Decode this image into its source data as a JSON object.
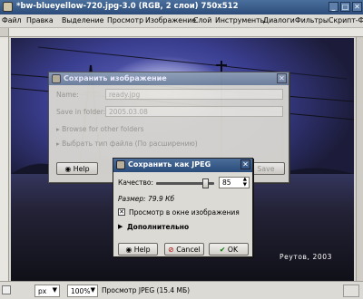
{
  "window": {
    "title": "*bw-blueyellow-720.jpg-3.0 (RGB, 2 слои) 750x512",
    "menu": [
      "Файл",
      "Правка",
      "Выделение",
      "Просмотр",
      "Изображение",
      "Слой",
      "Инструменты",
      "Диалоги",
      "Фильтры",
      "Скрипт-Ф"
    ]
  },
  "image": {
    "watermark": "Реутов, 2003"
  },
  "status": {
    "unit": "px",
    "zoom": "100%",
    "text": "Просмотр JPEG (15.4 МБ)"
  },
  "save_dialog": {
    "title": "Сохранить изображение",
    "name_label": "Name:",
    "name_value": "ready.jpg",
    "folder_label": "Save in folder:",
    "folder_value": "2005.03.08",
    "browse": "Browse for other folders",
    "file_type": "Выбрать тип файла (По расширению)",
    "help": "Help",
    "save": "Save"
  },
  "jpeg_dialog": {
    "title": "Сохранить как JPEG",
    "quality_label": "Качество:",
    "quality_value": "85",
    "quality_fraction": 0.85,
    "size_text": "Размер: 79.9 Кб",
    "preview_label": "Просмотр в окне изображения",
    "preview_checked": true,
    "advanced_label": "Дополнительно",
    "help": "Help",
    "cancel": "Cancel",
    "ok": "OK"
  }
}
